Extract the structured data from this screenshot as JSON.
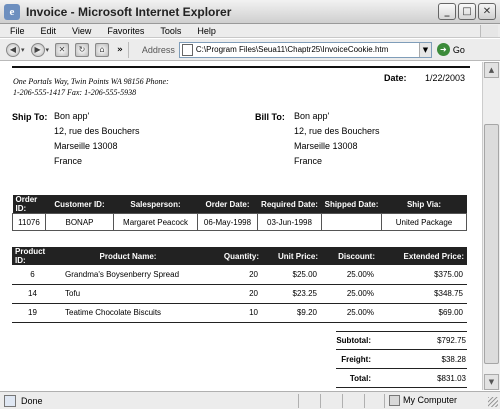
{
  "window": {
    "title": "Invoice - Microsoft Internet Explorer",
    "minimize": "_",
    "maximize": "□",
    "close": "✕"
  },
  "menu": [
    "File",
    "Edit",
    "View",
    "Favorites",
    "Tools",
    "Help"
  ],
  "toolbar": {
    "back_icon": "back-arrow-icon",
    "more": "»",
    "address_label": "Address",
    "address_value": "C:\\Program Files\\Seua11\\Chaptr25\\InvoiceCookie.htm",
    "go_label": "Go"
  },
  "invoice": {
    "company_line1": "One Portals Way, Twin Points WA 98156 Phone:",
    "company_line2": "1-206-555-1417 Fax: 1-206-555-5938",
    "date_label": "Date:",
    "date_value": "1/22/2003",
    "ship_to": {
      "label": "Ship To:",
      "lines": [
        "Bon app'",
        "12, rue des Bouchers",
        "Marseille  13008",
        "France"
      ]
    },
    "bill_to": {
      "label": "Bill To:",
      "lines": [
        "Bon app'",
        "12, rue des Bouchers",
        "Marseille  13008",
        "France"
      ]
    },
    "order_headers": [
      "Order ID:",
      "Customer ID:",
      "Salesperson:",
      "Order Date:",
      "Required Date:",
      "Shipped Date:",
      "Ship Via:"
    ],
    "order_row": [
      "11076",
      "BONAP",
      "Margaret Peacock",
      "06-May-1998",
      "03-Jun-1998",
      "",
      "United Package"
    ],
    "product_headers": [
      "Product ID:",
      "Product Name:",
      "Quantity:",
      "Unit Price:",
      "Discount:",
      "Extended Price:"
    ],
    "products": [
      [
        "6",
        "Grandma's Boysenberry Spread",
        "20",
        "$25.00",
        "25.00%",
        "$375.00"
      ],
      [
        "14",
        "Tofu",
        "20",
        "$23.25",
        "25.00%",
        "$348.75"
      ],
      [
        "19",
        "Teatime Chocolate Biscuits",
        "10",
        "$9.20",
        "25.00%",
        "$69.00"
      ]
    ],
    "totals": [
      {
        "label": "Subtotal:",
        "value": "$792.75"
      },
      {
        "label": "Freight:",
        "value": "$38.28"
      },
      {
        "label": "Total:",
        "value": "$831.03"
      }
    ]
  },
  "status": {
    "left": "Done",
    "zone": "My Computer"
  }
}
